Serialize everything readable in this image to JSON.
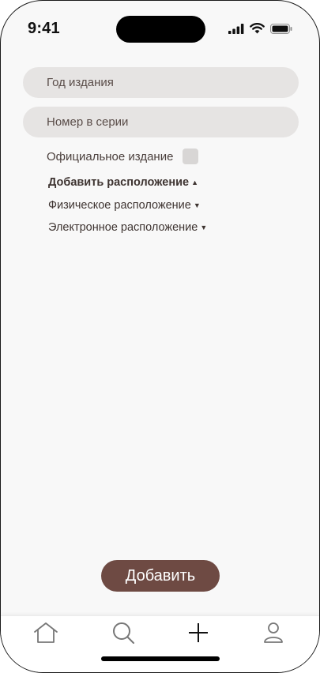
{
  "status_bar": {
    "time": "9:41"
  },
  "form": {
    "year_placeholder": "Год издания",
    "series_number_placeholder": "Номер в серии",
    "official_edition_label": "Официальное издание",
    "official_edition_checked": false
  },
  "location": {
    "add_label": "Добавить расположение",
    "add_icon": "triangle-up",
    "physical_label": "Физическое расположение",
    "electronic_label": "Электронное расположение",
    "expand_icon": "triangle-down"
  },
  "actions": {
    "add_button_label": "Добавить"
  },
  "tab_bar": {
    "items": [
      "home-icon",
      "search-icon",
      "plus-icon",
      "person-icon"
    ]
  },
  "colors": {
    "accent": "#6e4a43",
    "field_bg": "#e6e4e3",
    "text": "#4a3f3c",
    "background": "#f8f8f8"
  }
}
